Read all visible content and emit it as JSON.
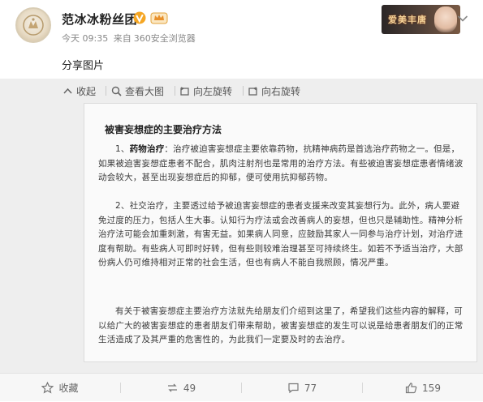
{
  "post": {
    "author": "范冰冰粉丝团",
    "time": "今天 09:35",
    "source_prefix": "来自",
    "source": "360安全浏览器",
    "text": "分享图片",
    "banner_text": "爱美丰唐"
  },
  "toolbar": {
    "collapse": "收起",
    "view_large": "查看大图",
    "rotate_left": "向左旋转",
    "rotate_right": "向右旋转"
  },
  "image": {
    "title": "被害妄想症的主要治疗方法",
    "p1_label": "药物治疗",
    "p1_prefix": "1、",
    "p1_body": "：治疗被迫害妄想症主要依靠药物，抗精神病药是首选治疗药物之一。但是，如果被迫害妄想症患者不配合，肌肉注射剂也是常用的治疗方法。有些被迫害妄想症患者情绪波动会较大，甚至出现妄想症后的抑郁，便可使用抗抑郁药物。",
    "p2": "2、社交治疗，主要透过给予被迫害妄想症的患者支援来改变其妄想行为。此外，病人要避免过度的压力，包括人生大事。认知行为疗法或会改善病人的妄想，但也只是辅助性。精神分析治疗法可能会加重刺激，有害无益。如果病人同意，应鼓励其家人一同参与治疗计划，对治疗进度有帮助。有些病人可即时好转，但有些则较难治理甚至可持续终生。如若不予适当治疗，大部份病人仍可维持相对正常的社会生活，但也有病人不能自我照顾，情况严重。",
    "p3": "有关于被害妄想症主要治疗方法就先给朋友们介绍到这里了，希望我们这些内容的解释，可以给广大的被害妄想症的患者朋友们带来帮助，被害妄想症的发生可以说是给患者朋友们的正常生活造成了及其严重的危害性的，为此我们一定要及时的去治疗。"
  },
  "actions": {
    "favorite": "收藏",
    "repost_count": "49",
    "comment_count": "77",
    "like_count": "159"
  },
  "colors": {
    "verified": "#f5a623",
    "link": "#555555"
  }
}
